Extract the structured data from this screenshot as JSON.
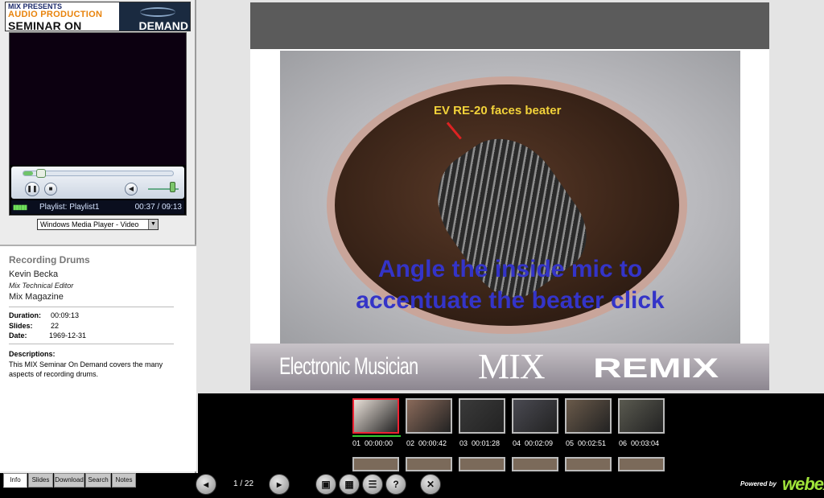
{
  "banner": {
    "line1": "MIX PRESENTS",
    "line2": "AUDIO PRODUCTION",
    "line3a": "SEMINAR ON",
    "line3b": "DEMAND"
  },
  "player": {
    "progress_fraction": 0.067,
    "volume_fraction": 0.9,
    "status_playlist": "Playlist: Playlist1",
    "status_time": "00:37 / 09:13",
    "mode_select": "Windows Media Player - Video"
  },
  "info": {
    "title": "Recording Drums",
    "presenter": "Kevin Becka",
    "role": "Mix Technical Editor",
    "org": "Mix Magazine",
    "meta": [
      {
        "label": "Duration:",
        "value": "00:09:13"
      },
      {
        "label": "Slides:",
        "value": "22"
      },
      {
        "label": "Date:",
        "value": "1969-12-31"
      }
    ],
    "desc_heading": "Descriptions:",
    "desc": "This MIX Seminar On Demand covers the many aspects of recording drums."
  },
  "tabs": [
    {
      "label": "Info",
      "active": true
    },
    {
      "label": "Slides",
      "active": false
    },
    {
      "label": "Download",
      "active": false
    },
    {
      "label": "Search",
      "active": false
    },
    {
      "label": "Notes",
      "active": false
    }
  ],
  "slide": {
    "callout": "EV RE-20 faces beater",
    "overlay_line1": "Angle the inside mic to",
    "overlay_line2": "accentuate the beater click",
    "logo_em": "Electronic Musician",
    "logo_mix": "MIX",
    "logo_remix": "REMIX"
  },
  "thumbnails": [
    {
      "num": "01",
      "time": "00:00:00",
      "color": "#e9e0d8",
      "active": true
    },
    {
      "num": "02",
      "time": "00:00:42",
      "color": "#8a6a5a",
      "active": false
    },
    {
      "num": "03",
      "time": "00:01:28",
      "color": "#3a3a3a",
      "active": false
    },
    {
      "num": "04",
      "time": "00:02:09",
      "color": "#4a4a52",
      "active": false
    },
    {
      "num": "05",
      "time": "00:02:51",
      "color": "#6a5a4a",
      "active": false
    },
    {
      "num": "06",
      "time": "00:03:04",
      "color": "#5a5a50",
      "active": false
    }
  ],
  "toolbar": {
    "page_indicator": "1 / 22",
    "powered_by": "Powered by",
    "brand": "webex"
  }
}
